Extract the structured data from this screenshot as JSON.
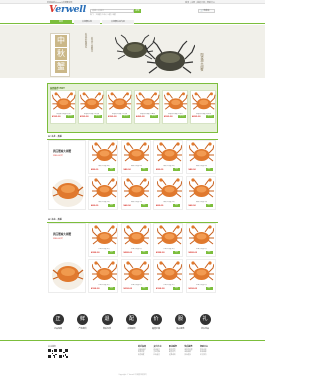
{
  "header": {
    "top_left": "欢迎来到Verwell大闸蟹官网",
    "top_right": "登录 | 注册 | 我的订单 | 帮助中心",
    "logo_v": "V",
    "logo_rest": "erwell",
    "search_placeholder": "请输入关键字",
    "search_button": "搜索",
    "hot_words": "热门： 大闸蟹 | 礼券 | 公蟹 | 母蟹",
    "cart_label": "购物车"
  },
  "nav": {
    "items": [
      "首页",
      "大闸蟹礼券",
      "大闸蟹礼盒专区"
    ]
  },
  "banner": {
    "seal_chars": [
      "中",
      "秋",
      "蟹"
    ],
    "poem_lines": [
      "秋风起 蟹脚痒",
      "菊花开 闻蟹来"
    ],
    "vertical_title": "阳澄湖大闸蟹"
  },
  "promo": {
    "title": "热销推荐 HOT",
    "items": [
      {
        "name": "阳澄湖大闸蟹 8只装",
        "price": "¥199.00",
        "buy": "立即购买"
      },
      {
        "name": "阳澄湖大闸蟹 10只装",
        "price": "¥299.00",
        "buy": "立即购买"
      },
      {
        "name": "阳澄湖大闸蟹 12只装",
        "price": "¥399.00",
        "buy": "立即购买"
      },
      {
        "name": "阳澄湖大闸蟹 礼盒装",
        "price": "¥499.00",
        "buy": "立即购买"
      },
      {
        "name": "阳澄湖大闸蟹 公母对",
        "price": "¥599.00",
        "buy": "立即购买"
      },
      {
        "name": "阳澄湖大闸蟹 尊享装",
        "price": "¥699.00",
        "buy": "立即购买"
      }
    ]
  },
  "sections": [
    {
      "title": "1F 礼券 · 热销",
      "side_title": "周庄蟹城大闸蟹",
      "side_price": "¥88.00/只",
      "items": [
        {
          "name": "精品大闸蟹 4两",
          "price": "¥88.00",
          "buy": "购买"
        },
        {
          "name": "精品大闸蟹 4两",
          "price": "¥88.00",
          "buy": "购买"
        },
        {
          "name": "精品大闸蟹 4两",
          "price": "¥88.00",
          "buy": "购买"
        },
        {
          "name": "精品大闸蟹 4两",
          "price": "¥88.00",
          "buy": "购买"
        },
        {
          "name": "精品大闸蟹 3两",
          "price": "¥68.00",
          "buy": "购买"
        },
        {
          "name": "精品大闸蟹 3两",
          "price": "¥68.00",
          "buy": "购买"
        },
        {
          "name": "精品大闸蟹 3两",
          "price": "¥68.00",
          "buy": "购买"
        },
        {
          "name": "精品大闸蟹 3两",
          "price": "¥68.00",
          "buy": "购买"
        }
      ]
    },
    {
      "title": "2F 礼盒 · 热销",
      "side_title": "周庄蟹城大闸蟹",
      "side_price": "¥88.00/只",
      "items": [
        {
          "name": "礼盒大闸蟹 8只",
          "price": "¥288.00",
          "buy": "购买"
        },
        {
          "name": "礼盒大闸蟹 8只",
          "price": "¥288.00",
          "buy": "购买"
        },
        {
          "name": "礼盒大闸蟹 8只",
          "price": "¥288.00",
          "buy": "购买"
        },
        {
          "name": "礼盒大闸蟹 8只",
          "price": "¥288.00",
          "buy": "购买"
        },
        {
          "name": "礼盒大闸蟹 6只",
          "price": "¥198.00",
          "buy": "购买"
        },
        {
          "name": "礼盒大闸蟹 6只",
          "price": "¥198.00",
          "buy": "购买"
        },
        {
          "name": "礼盒大闸蟹 6只",
          "price": "¥198.00",
          "buy": "购买"
        },
        {
          "name": "礼盒大闸蟹 6只",
          "price": "¥198.00",
          "buy": "购买"
        }
      ]
    }
  ],
  "features": [
    {
      "icon": "正",
      "label": "正品保障"
    },
    {
      "icon": "鲜",
      "label": "产地直供"
    },
    {
      "icon": "退",
      "label": "售后无忧"
    },
    {
      "icon": "配",
      "label": "冷链配送"
    },
    {
      "icon": "价",
      "label": "超值价格"
    },
    {
      "icon": "服",
      "label": "贴心服务"
    },
    {
      "icon": "礼",
      "label": "送礼佳品"
    }
  ],
  "footer": {
    "qr_title": "关注我们",
    "columns": [
      {
        "head": "新手指南",
        "links": [
          "注册新用户",
          "购物流程",
          "会员制度"
        ]
      },
      {
        "head": "支付方式",
        "links": [
          "在线支付",
          "货到付款",
          "礼券支付"
        ]
      },
      {
        "head": "配送服务",
        "links": [
          "配送范围",
          "配送时间",
          "运费说明"
        ]
      },
      {
        "head": "售后服务",
        "links": [
          "退换货政策",
          "退款说明",
          "投诉建议"
        ]
      },
      {
        "head": "帮助中心",
        "links": [
          "常见问题",
          "联系客服",
          "关于我们"
        ]
      }
    ],
    "copyright": "Copyright © Verwell 大闸蟹 版权所有"
  },
  "colors": {
    "accent": "#7cbe3c",
    "price": "#d9322a",
    "crab": "#e0792e"
  }
}
